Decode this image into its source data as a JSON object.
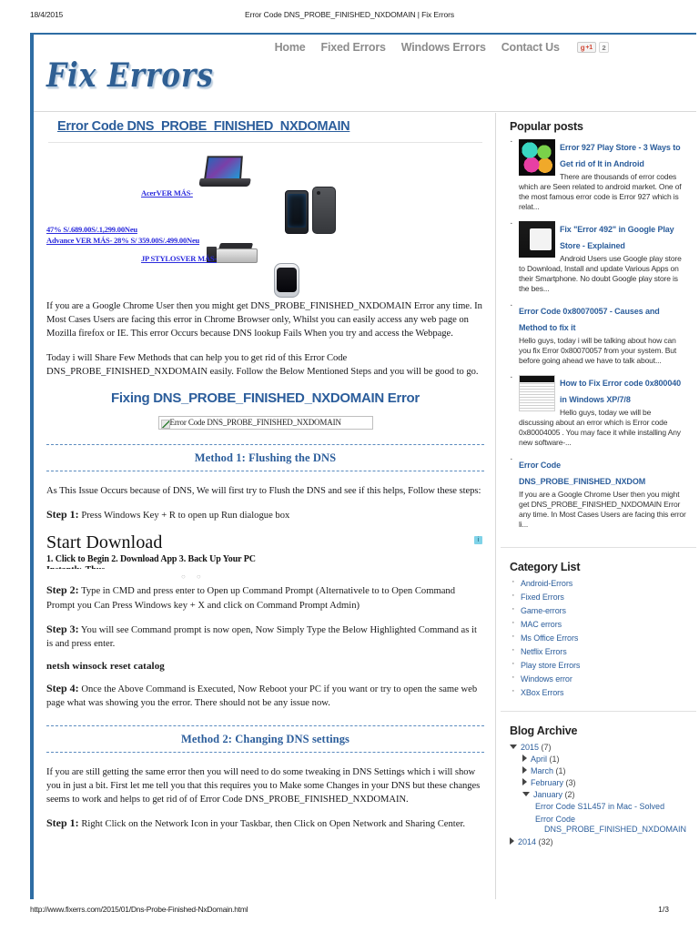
{
  "print": {
    "date": "18/4/2015",
    "title": "Error Code DNS_PROBE_FINISHED_NXDOMAIN | Fix Errors",
    "url": "http://www.fixerrs.com/2015/01/Dns-Probe-Finished-NxDomain.html",
    "page": "1/3"
  },
  "header": {
    "logo": "Fix Errors",
    "nav": [
      "Home",
      "Fixed Errors",
      "Windows Errors",
      "Contact Us"
    ],
    "gplus_label": "g",
    "gplus_plus": "+1",
    "gplus_count": "2"
  },
  "post": {
    "title": "Error Code DNS_PROBE_FINISHED_NXDOMAIN",
    "para1": "If you are a Google Chrome User then you might get DNS_PROBE_FINISHED_NXDOMAIN Error any time. In Most Cases Users are facing this error in Chrome Browser only, Whilst you can easily access any web page on Mozilla firefox or IE. This error Occurs because DNS lookup Fails When you try and access the Webpage.",
    "para2": "Today i will Share Few Methods that can help you to get rid of this Error Code DNS_PROBE_FINISHED_NXDOMAIN easily. Follow the Below Mentioned Steps and you will be good to go.",
    "fixing_heading": "Fixing DNS_PROBE_FINISHED_NXDOMAIN Error",
    "broken_image_alt": "Error Code DNS_PROBE_FINISHED_NXDOMAIN"
  },
  "ad_products": {
    "link1": "AcerVER MÁS-",
    "link2": "47% S/.689.00S/.1,299.00Neu",
    "link3": "Advance VER MÁS- 28% S/ 359.00S/.499.00Neu",
    "link4": "JP STYLOSVER MÁS-"
  },
  "method1": {
    "title": "Method 1: Flushing the DNS",
    "intro": "As This Issue Occurs because of DNS, We will first try to Flush the DNS and see if this helps, Follow these steps:",
    "step1_label": "Step 1:",
    "step1_text": " Press Windows Key + R to open up Run dialogue box",
    "step2_label": "Step 2:",
    "step2_text": " Type in CMD and press enter to Open up Command Prompt (Alternativele to to Open Command Prompt you Can Press Windows key + X and click on Command Prompt Admin)",
    "step3_label": "Step 3:",
    "step3_text": " You will see Command prompt is now open, Now Simply Type the Below Highlighted Command as it is and press enter.",
    "command": "netsh winsock reset catalog",
    "step4_label": "Step 4:",
    "step4_text": " Once the Above Command is Executed, Now Reboot your PC if you want or try to open the same web page what was showing you the error. There should not be any issue now."
  },
  "download_ad": {
    "title": "Start Download",
    "sub": "1. Click to Begin 2. Download App 3. Back Up Your PC",
    "sub2": "Instantly. Thus",
    "adchoice": "i"
  },
  "method2": {
    "title": "Method 2: Changing DNS settings",
    "intro": "If you are still getting the same error then you will need to do some tweaking in DNS Settings which i will show you in just a bit. First let me tell you that this requires you to Make some Changes in your DNS but these changes seems to work and helps to get rid of of Error Code DNS_PROBE_FINISHED_NXDOMAIN.",
    "step1_label": "Step 1:",
    "step1_text": " Right Click on the Network Icon in your Taskbar, then Click on Open Network and Sharing Center."
  },
  "sidebar": {
    "popular": {
      "heading": "Popular posts",
      "items": [
        {
          "thumb": "android-robot-icon",
          "title": "Error 927 Play Store - 3 Ways to Get rid of It in Android",
          "snippet": "There are thousands of error codes which are Seen related to android market. One of the most famous error code is Error 927 which is relat..."
        },
        {
          "thumb": "play-store-box-icon",
          "title": "Fix \"Error 492\" in Google Play Store - Explained",
          "snippet": "Android Users use Google play store to Download, Install and update Various Apps on their Smartphone. No doubt Google play store is the bes..."
        },
        {
          "thumb": "none",
          "title": "Error Code 0x80070057 - Causes and Method to fix it",
          "snippet": "Hello guys, today i will be talking about how can you fix Error 0x80070057 from your system. But before going ahead we have to talk about..."
        },
        {
          "thumb": "document-icon",
          "title": "How to Fix Error code 0x800040 in Windows XP/7/8",
          "snippet": "Hello guys, today we will be discussing about an error which is Error code 0x80004005 . You may face it while installing Any new software-..."
        },
        {
          "thumb": "none",
          "title": "Error Code DNS_PROBE_FINISHED_NXDOM",
          "snippet": "If you are a Google Chrome User then you might get DNS_PROBE_FINISHED_NXDOMAIN Error any time. In Most Cases Users are facing this error li..."
        }
      ]
    },
    "categories": {
      "heading": "Category List",
      "items": [
        "Android-Errors",
        "Fixed Errors",
        "Game-errors",
        "MAC errors",
        "Ms Office Errors",
        "Netflix Errors",
        "Play store Errors",
        "Windows error",
        "XBox Errors"
      ]
    },
    "archive": {
      "heading": "Blog Archive",
      "year_2015": "2015",
      "year_2015_count": "(7)",
      "months": [
        {
          "name": "April",
          "count": "(1)"
        },
        {
          "name": "March",
          "count": "(1)"
        },
        {
          "name": "February",
          "count": "(3)"
        },
        {
          "name": "January",
          "count": "(2)"
        }
      ],
      "jan_posts_1": "Error Code S1L457 in Mac - Solved",
      "jan_posts_2a": "Error Code",
      "jan_posts_2b": "DNS_PROBE_FINISHED_NXDOMAIN",
      "year_2014": "2014",
      "year_2014_count": "(32)"
    }
  }
}
